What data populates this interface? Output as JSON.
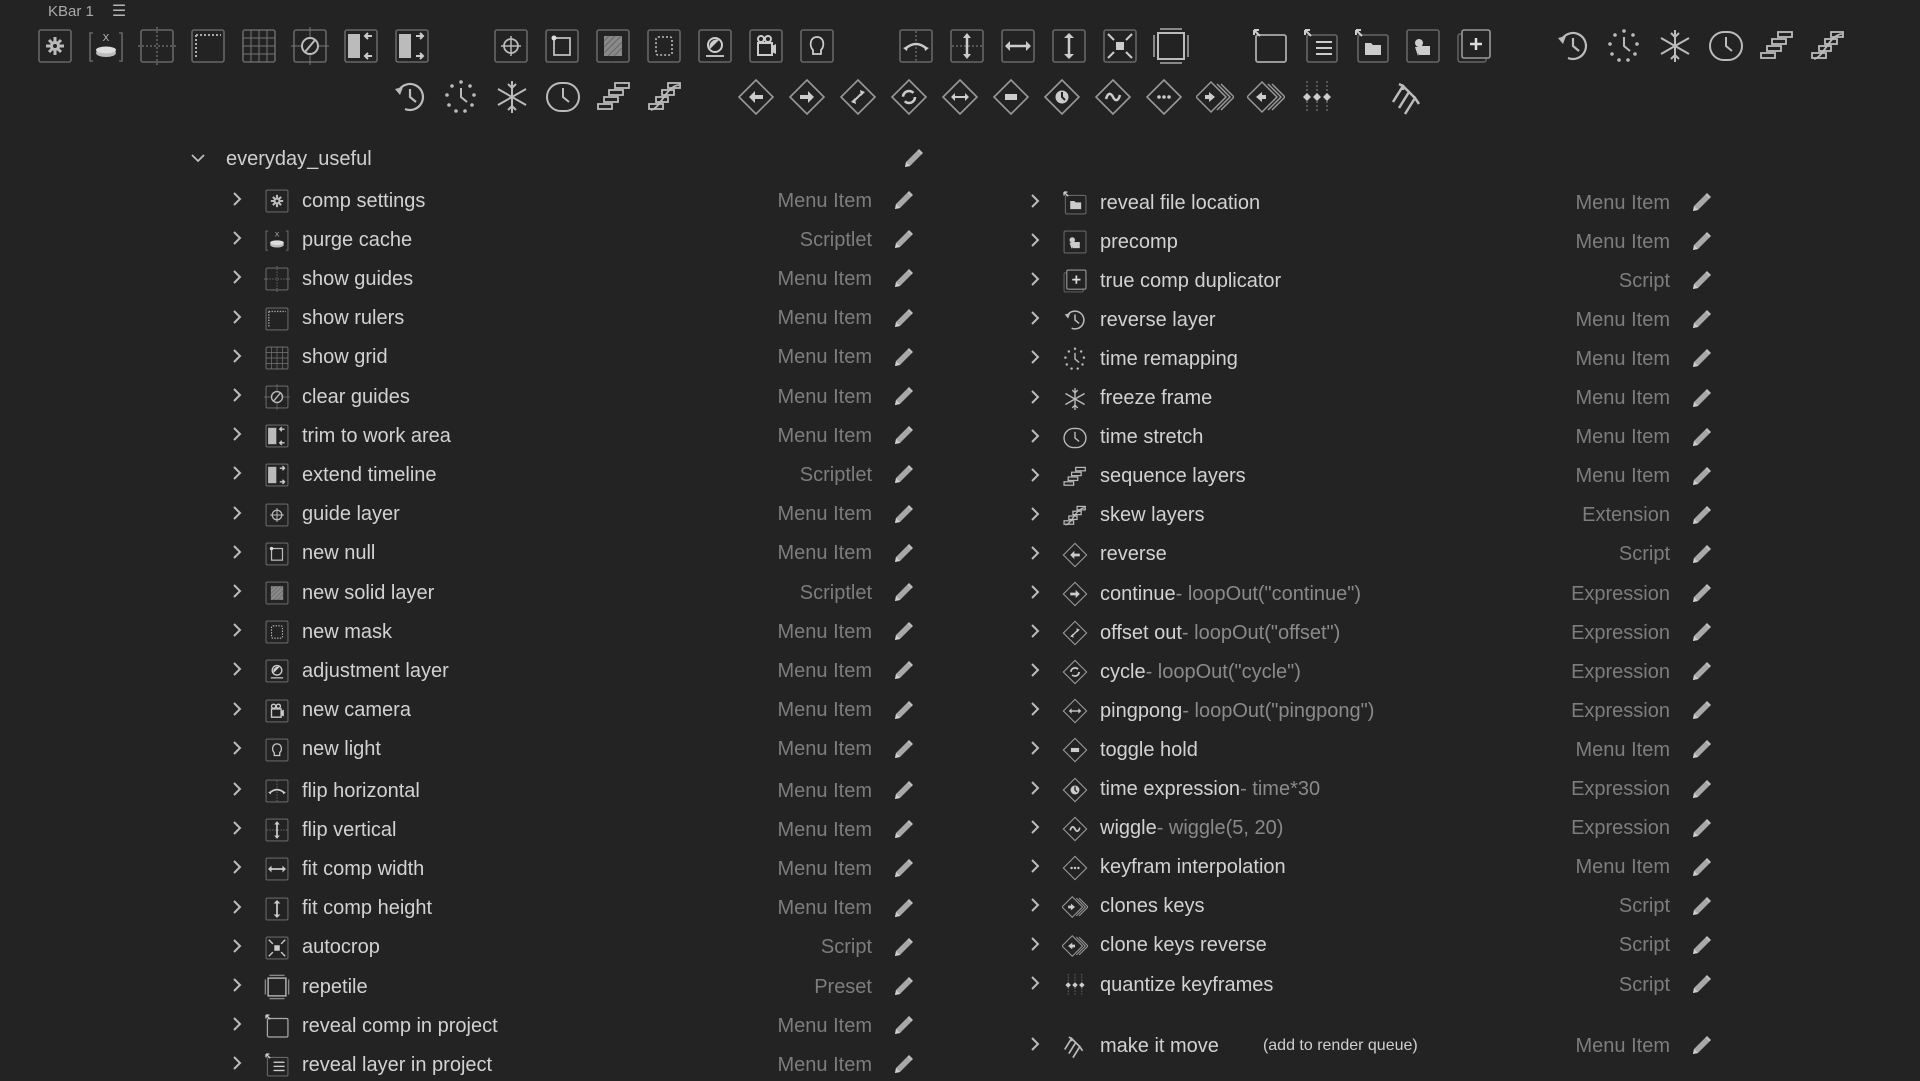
{
  "window": {
    "title": "KBar 1",
    "menu_icon": "hamburger-icon"
  },
  "toolbar_row1": [
    {
      "icon": "comp-settings-icon",
      "group": 1
    },
    {
      "icon": "purge-cache-icon",
      "group": 1
    },
    {
      "icon": "show-guides-icon",
      "group": 1
    },
    {
      "icon": "show-rulers-icon",
      "group": 1
    },
    {
      "icon": "show-grid-icon",
      "group": 1
    },
    {
      "icon": "clear-guides-icon",
      "group": 1
    },
    {
      "icon": "trim-to-work-area-icon",
      "group": 1
    },
    {
      "icon": "extend-timeline-icon",
      "group": 1
    },
    {
      "icon": "guide-layer-icon",
      "group": 2
    },
    {
      "icon": "new-null-icon",
      "group": 2
    },
    {
      "icon": "new-solid-layer-icon",
      "group": 2
    },
    {
      "icon": "new-mask-icon",
      "group": 2
    },
    {
      "icon": "adjustment-layer-icon",
      "group": 2
    },
    {
      "icon": "new-camera-icon",
      "group": 2
    },
    {
      "icon": "new-light-icon",
      "group": 2
    },
    {
      "icon": "flip-horizontal-icon",
      "group": 3
    },
    {
      "icon": "flip-vertical-icon",
      "group": 3
    },
    {
      "icon": "fit-comp-width-icon",
      "group": 3
    },
    {
      "icon": "fit-comp-height-icon",
      "group": 3
    },
    {
      "icon": "autocrop-icon",
      "group": 3
    },
    {
      "icon": "repetile-icon",
      "group": 3
    },
    {
      "icon": "reveal-comp-icon",
      "group": 4
    },
    {
      "icon": "reveal-layer-icon",
      "group": 4
    },
    {
      "icon": "reveal-file-icon",
      "group": 4
    },
    {
      "icon": "precomp-icon",
      "group": 4
    },
    {
      "icon": "true-comp-duplicator-icon",
      "group": 4
    },
    {
      "icon": "reverse-layer-icon",
      "group": 5
    },
    {
      "icon": "time-remapping-icon",
      "group": 5
    },
    {
      "icon": "freeze-frame-icon",
      "group": 5
    },
    {
      "icon": "time-stretch-icon",
      "group": 5
    },
    {
      "icon": "sequence-layers-icon",
      "group": 5
    },
    {
      "icon": "skew-layers-icon",
      "group": 5
    }
  ],
  "toolbar_row2": [
    {
      "icon": "reverse-layer-icon",
      "group": 1
    },
    {
      "icon": "time-remapping-icon",
      "group": 1
    },
    {
      "icon": "freeze-frame-icon",
      "group": 1
    },
    {
      "icon": "time-stretch-icon",
      "group": 1
    },
    {
      "icon": "sequence-layers-icon",
      "group": 1
    },
    {
      "icon": "skew-layers-icon",
      "group": 1
    },
    {
      "icon": "reverse-keys-icon",
      "group": 2
    },
    {
      "icon": "loop-continue-icon",
      "group": 2
    },
    {
      "icon": "loop-offset-icon",
      "group": 2
    },
    {
      "icon": "loop-cycle-icon",
      "group": 2
    },
    {
      "icon": "loop-pingpong-icon",
      "group": 2
    },
    {
      "icon": "toggle-hold-icon",
      "group": 2
    },
    {
      "icon": "time-expression-icon",
      "group": 2
    },
    {
      "icon": "wiggle-icon",
      "group": 2
    },
    {
      "icon": "keyframe-interpolation-icon",
      "group": 2
    },
    {
      "icon": "clone-keys-icon",
      "group": 2
    },
    {
      "icon": "clone-keys-reverse-icon",
      "group": 2
    },
    {
      "icon": "quantize-keyframes-icon",
      "group": 2
    },
    {
      "icon": "make-it-move-icon",
      "group": 3
    }
  ],
  "group": {
    "name": "everyday_useful",
    "expanded": true
  },
  "left_items": [
    {
      "label": "comp settings",
      "type": "Menu Item",
      "icon": "comp-settings-icon"
    },
    {
      "label": "purge cache",
      "type": "Scriptlet",
      "icon": "purge-cache-icon"
    },
    {
      "label": "show guides",
      "type": "Menu Item",
      "icon": "show-guides-icon"
    },
    {
      "label": "show rulers",
      "type": "Menu Item",
      "icon": "show-rulers-icon"
    },
    {
      "label": "show grid",
      "type": "Menu Item",
      "icon": "show-grid-icon"
    },
    {
      "label": "clear guides",
      "type": "Menu Item",
      "icon": "clear-guides-icon"
    },
    {
      "label": "trim to work area",
      "type": "Menu Item",
      "icon": "trim-to-work-area-icon"
    },
    {
      "label": "extend timeline",
      "type": "Scriptlet",
      "icon": "extend-timeline-icon"
    },
    {
      "label": "guide layer",
      "type": "Menu Item",
      "icon": "guide-layer-icon"
    },
    {
      "label": "new null",
      "type": "Menu Item",
      "icon": "new-null-icon"
    },
    {
      "label": "new solid layer",
      "type": "Scriptlet",
      "icon": "new-solid-layer-icon"
    },
    {
      "label": "new mask",
      "type": "Menu Item",
      "icon": "new-mask-icon"
    },
    {
      "label": "adjustment layer",
      "type": "Menu Item",
      "icon": "adjustment-layer-icon"
    },
    {
      "label": "new camera",
      "type": "Menu Item",
      "icon": "new-camera-icon"
    },
    {
      "label": "new light",
      "type": "Menu Item",
      "icon": "new-light-icon"
    },
    {
      "label": "flip horizontal",
      "type": "Menu Item",
      "icon": "flip-horizontal-icon"
    },
    {
      "label": "flip vertical",
      "type": "Menu Item",
      "icon": "flip-vertical-icon"
    },
    {
      "label": "fit comp width",
      "type": "Menu Item",
      "icon": "fit-comp-width-icon"
    },
    {
      "label": "fit comp height",
      "type": "Menu Item",
      "icon": "fit-comp-height-icon"
    },
    {
      "label": "autocrop",
      "type": "Script",
      "icon": "autocrop-icon"
    },
    {
      "label": "repetile",
      "type": "Preset",
      "icon": "repetile-icon"
    },
    {
      "label": "reveal comp in project",
      "type": "Menu Item",
      "icon": "reveal-comp-icon"
    },
    {
      "label": "reveal layer in project",
      "type": "Menu Item",
      "icon": "reveal-layer-icon"
    }
  ],
  "right_items": [
    {
      "label": "reveal file location",
      "type": "Menu Item",
      "icon": "reveal-file-icon"
    },
    {
      "label": "precomp",
      "type": "Menu Item",
      "icon": "precomp-icon"
    },
    {
      "label": "true comp duplicator",
      "type": "Script",
      "icon": "true-comp-duplicator-icon"
    },
    {
      "label": "reverse layer",
      "type": "Menu Item",
      "icon": "reverse-layer-icon"
    },
    {
      "label": "time remapping",
      "type": "Menu Item",
      "icon": "time-remapping-icon"
    },
    {
      "label": "freeze frame",
      "type": "Menu Item",
      "icon": "freeze-frame-icon"
    },
    {
      "label": "time stretch",
      "type": "Menu Item",
      "icon": "time-stretch-icon"
    },
    {
      "label": "sequence layers",
      "type": "Menu Item",
      "icon": "sequence-layers-icon"
    },
    {
      "label": "skew layers",
      "type": "Extension",
      "icon": "skew-layers-icon"
    },
    {
      "label": "reverse",
      "type": "Script",
      "icon": "reverse-keys-icon"
    },
    {
      "label": "continue",
      "expr": " - loopOut(\"continue\")",
      "type": "Expression",
      "icon": "loop-continue-icon"
    },
    {
      "label": "offset out",
      "expr": " - loopOut(\"offset\")",
      "type": "Expression",
      "icon": "loop-offset-icon"
    },
    {
      "label": "cycle",
      "expr": " - loopOut(\"cycle\")",
      "type": "Expression",
      "icon": "loop-cycle-icon"
    },
    {
      "label": "pingpong",
      "expr": " - loopOut(\"pingpong\")",
      "type": "Expression",
      "icon": "loop-pingpong-icon"
    },
    {
      "label": "toggle hold",
      "type": "Menu Item",
      "icon": "toggle-hold-icon"
    },
    {
      "label": "time expression",
      "expr": " - time*30",
      "type": "Expression",
      "icon": "time-expression-icon"
    },
    {
      "label": "wiggle",
      "expr": " - wiggle(5, 20)",
      "type": "Expression",
      "icon": "wiggle-icon"
    },
    {
      "label": "keyfram interpolation",
      "type": "Menu Item",
      "icon": "keyframe-interpolation-icon"
    },
    {
      "label": "clones keys",
      "type": "Script",
      "icon": "clone-keys-icon"
    },
    {
      "label": "clone keys reverse",
      "type": "Script",
      "icon": "clone-keys-reverse-icon"
    },
    {
      "label": "quantize keyframes",
      "type": "Script",
      "icon": "quantize-keyframes-icon"
    },
    {
      "label": "make it move",
      "note": "(add to render queue)",
      "type": "Menu Item",
      "icon": "make-it-move-icon"
    }
  ]
}
